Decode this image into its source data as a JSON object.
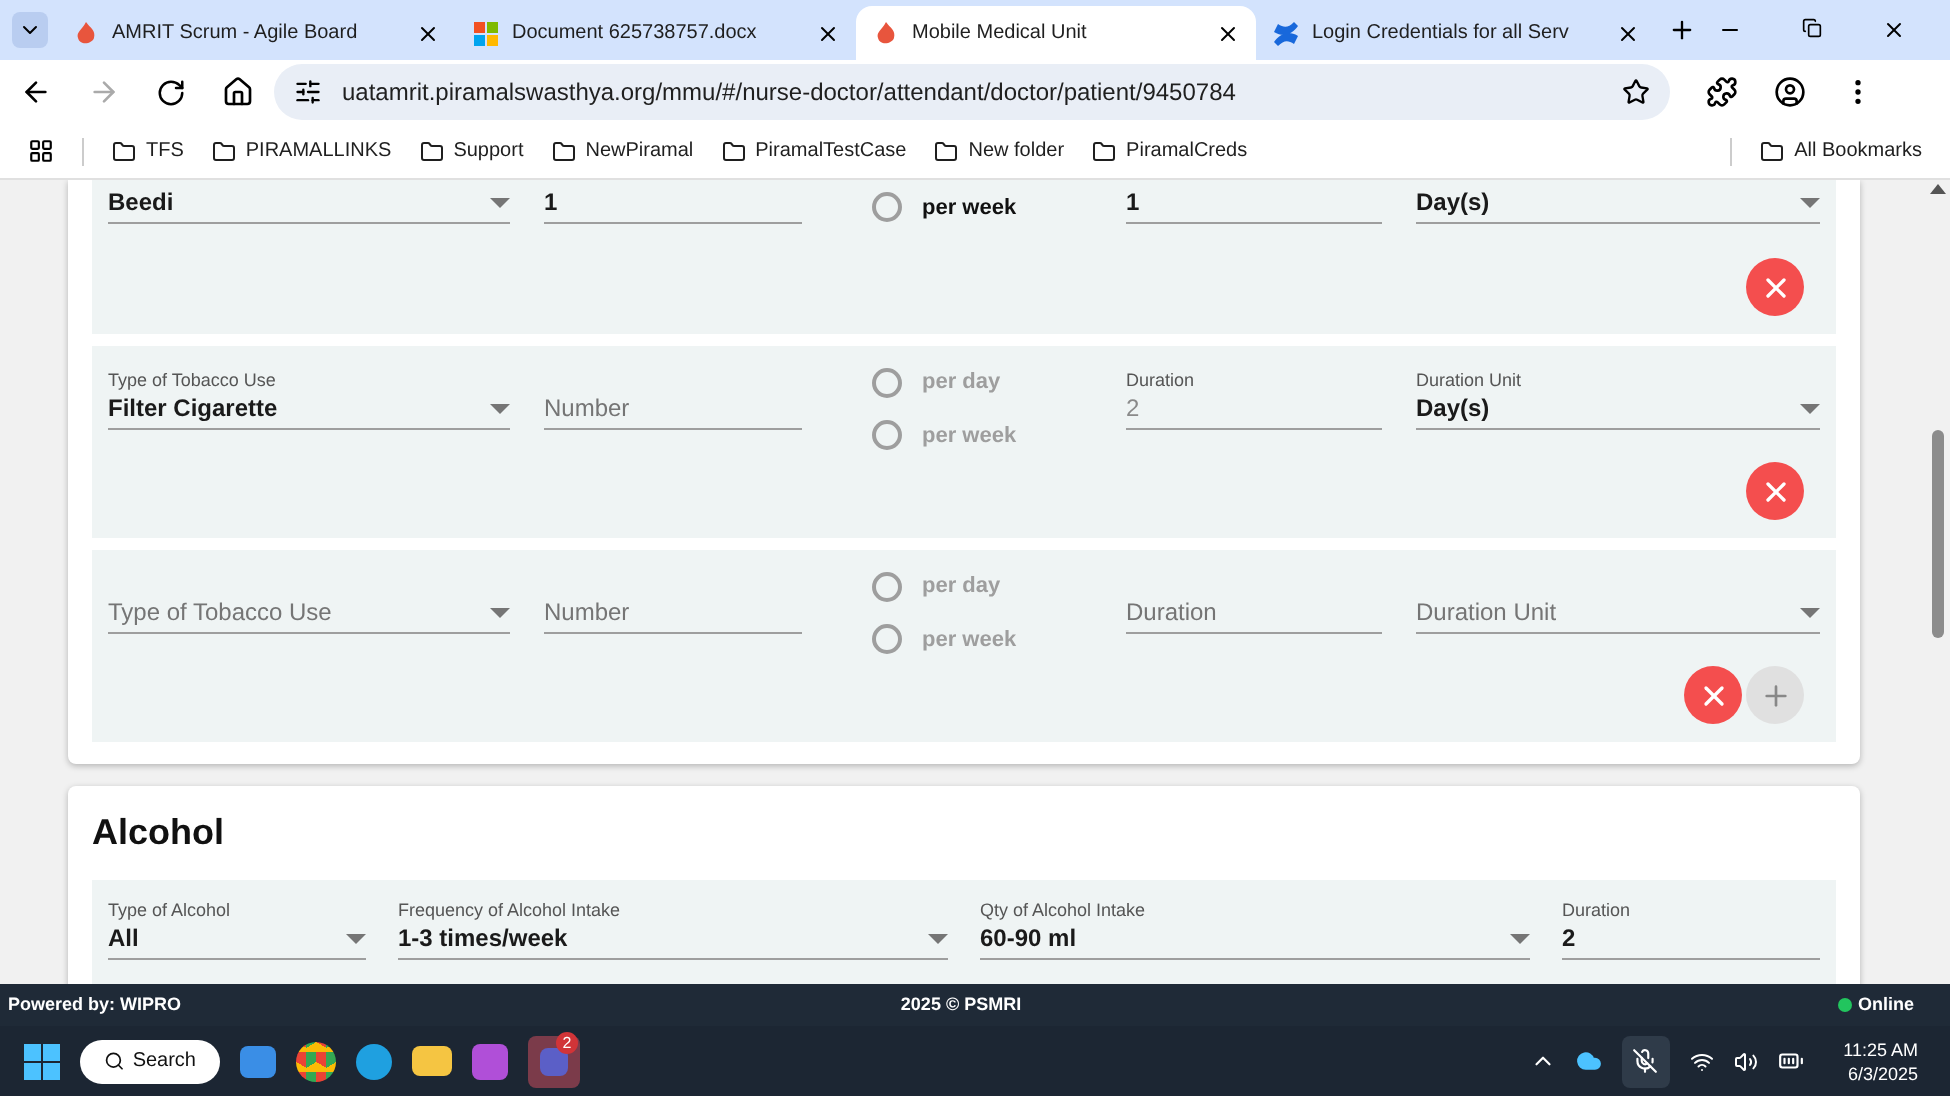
{
  "browser": {
    "tabs": [
      {
        "title": "AMRIT Scrum - Agile Board",
        "selected": false
      },
      {
        "title": "Document 625738757.docx",
        "selected": false
      },
      {
        "title": "Mobile Medical Unit",
        "selected": true
      },
      {
        "title": "Login Credentials for all Serv",
        "selected": false
      }
    ],
    "address": "uatamrit.piramalswasthya.org/mmu/#/nurse-doctor/attendant/doctor/patient/9450784",
    "bookmarks": [
      "TFS",
      "PIRAMALLINKS",
      "Support",
      "NewPiramal",
      "PiramalTestCase",
      "New folder",
      "PiramalCreds"
    ],
    "all_bookmarks": "All Bookmarks"
  },
  "tobacco_rows": [
    {
      "disabled": false,
      "add": false,
      "type": {
        "value": "Beedi"
      },
      "number": {
        "value": "1"
      },
      "frequency": [
        {
          "label": "per week",
          "selected": false
        }
      ],
      "duration": {
        "value": "1"
      },
      "duration_unit": {
        "value": "Day(s)"
      }
    },
    {
      "disabled": true,
      "add": false,
      "type": {
        "label": "Type of Tobacco Use",
        "value": "Filter Cigarette"
      },
      "number": {
        "placeholder": "Number"
      },
      "frequency": [
        {
          "label": "per day",
          "selected": false
        },
        {
          "label": "per week",
          "selected": false
        }
      ],
      "duration": {
        "label": "Duration",
        "value": "2"
      },
      "duration_unit": {
        "label": "Duration Unit",
        "value": "Day(s)"
      }
    },
    {
      "disabled": true,
      "add": true,
      "type": {
        "placeholder": "Type of Tobacco Use"
      },
      "number": {
        "placeholder": "Number"
      },
      "frequency": [
        {
          "label": "per day",
          "selected": false
        },
        {
          "label": "per week",
          "selected": false
        }
      ],
      "duration": {
        "placeholder": "Duration"
      },
      "duration_unit": {
        "placeholder": "Duration Unit"
      }
    }
  ],
  "alcohol": {
    "title": "Alcohol",
    "fields": [
      {
        "kind": "select",
        "label": "Type of Alcohol",
        "value": "All"
      },
      {
        "kind": "select",
        "label": "Frequency of Alcohol Intake",
        "value": "1-3 times/week"
      },
      {
        "kind": "select",
        "label": "Qty of Alcohol Intake",
        "value": "60-90 ml"
      },
      {
        "kind": "text",
        "label": "Duration",
        "value": "2"
      }
    ]
  },
  "footer": {
    "powered_by": "Powered by: WIPRO",
    "copyright": "2025 © PSMRI",
    "status": "Online",
    "online": true
  },
  "taskbar": {
    "search": "Search",
    "teams_badge": "2",
    "time": "11:25 AM",
    "date": "6/3/2025"
  }
}
